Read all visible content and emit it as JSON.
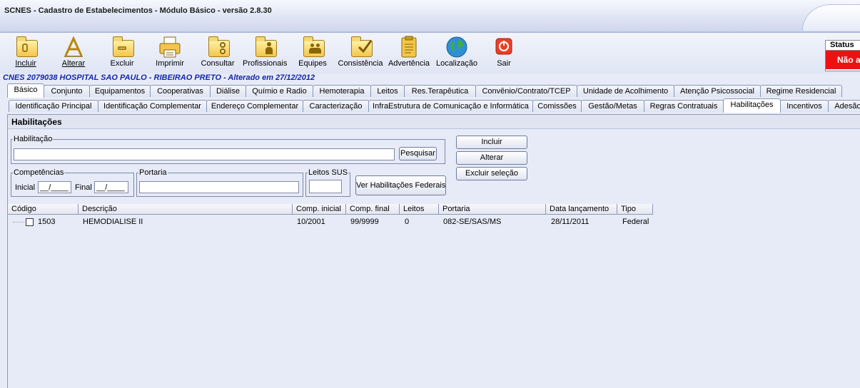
{
  "window": {
    "title": "SCNES - Cadastro de Estabelecimentos - Módulo Básico - versão 2.8.30"
  },
  "toolbar": {
    "buttons": [
      {
        "label": "Incluir",
        "icon": "folder-include-icon"
      },
      {
        "label": "Alterar",
        "icon": "alter-icon"
      },
      {
        "label": "Excluir",
        "icon": "folder-delete-icon"
      },
      {
        "label": "Imprimir",
        "icon": "printer-icon"
      },
      {
        "label": "Consultar",
        "icon": "binoculars-folder-icon"
      },
      {
        "label": "Profissionais",
        "icon": "professionals-folder-icon"
      },
      {
        "label": "Equipes",
        "icon": "team-folder-icon"
      },
      {
        "label": "Consistência",
        "icon": "check-folder-icon"
      },
      {
        "label": "Advertência",
        "icon": "clipboard-icon"
      },
      {
        "label": "Localização",
        "icon": "globe-icon"
      },
      {
        "label": "Sair",
        "icon": "power-icon"
      }
    ]
  },
  "status": {
    "label": "Status",
    "value": "Não a"
  },
  "establishment": {
    "line": "CNES 2079038  HOSPITAL SAO PAULO - RIBEIRAO PRETO - Alterado em 27/12/2012"
  },
  "tabs_main": [
    "Básico",
    "Conjunto",
    "Equipamentos",
    "Cooperativas",
    "Diálise",
    "Químio e Radio",
    "Hemoterapia",
    "Leitos",
    "Res.Terapêutica",
    "Convênio/Contrato/TCEP",
    "Unidade de Acolhimento",
    "Atenção Psicossocial",
    "Regime Residencial"
  ],
  "tabs_sub": [
    "Identificação Principal",
    "Identificação Complementar",
    "Endereço Complementar",
    "Caracterização",
    "InfraEstrutura de Comunicação e Informática",
    "Comissões",
    "Gestão/Metas",
    "Regras Contratuais",
    "Habilitações",
    "Incentivos",
    "Adesão"
  ],
  "panel": {
    "title": "Habilitações",
    "habilitacao_legend": "Habilitação",
    "pesquisar": "Pesquisar",
    "competencias_legend": "Competências",
    "inicial_label": "Inicial",
    "inicial_value": "__/____",
    "final_label": "Final",
    "final_value": "__/____",
    "portaria_legend": "Portaria",
    "leitos_legend": "Leitos SUS",
    "ver_federais": "Ver Habilitações Federais",
    "incluir": "Incluir",
    "alterar": "Alterar",
    "excluir_selecao": "Excluir seleção"
  },
  "grid": {
    "columns": [
      "Código",
      "Descrição",
      "Comp. inicial",
      "Comp. final",
      "Leitos",
      "Portaria",
      "Data lançamento",
      "Tipo"
    ],
    "rows": [
      {
        "codigo": "1503",
        "descricao": "HEMODIALISE II",
        "comp_inicial": "10/2001",
        "comp_final": "99/9999",
        "leitos": "0",
        "portaria": "082-SE/SAS/MS",
        "data_lancamento": "28/11/2011",
        "tipo": "Federal"
      }
    ]
  }
}
